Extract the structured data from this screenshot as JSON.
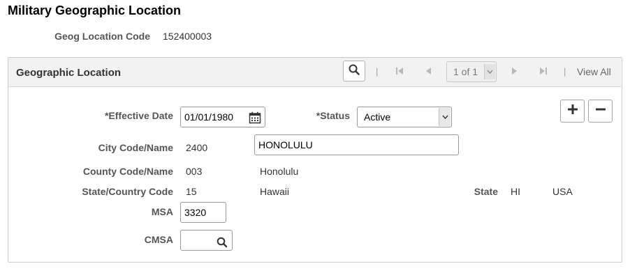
{
  "page_title": "Military Geographic Location",
  "header": {
    "geog_code_label": "Geog Location Code",
    "geog_code_value": "152400003"
  },
  "panel": {
    "title": "Geographic Location",
    "pager_text": "1 of 1",
    "view_all": "View All",
    "separators": [
      "|",
      "|",
      "|"
    ]
  },
  "form": {
    "effective_date_label": "*Effective Date",
    "effective_date_value": "01/01/1980",
    "status_label": "*Status",
    "status_value": "Active",
    "city_label": "City Code/Name",
    "city_code": "2400",
    "city_name": "HONOLULU",
    "county_label": "County Code/Name",
    "county_code": "003",
    "county_name": "Honolulu",
    "state_country_label": "State/Country Code",
    "state_country_code": "15",
    "state_country_name": "Hawaii",
    "state_label": "State",
    "state_value": "HI",
    "country_value": "USA",
    "msa_label": "MSA",
    "msa_value": "3320",
    "cmsa_label": "CMSA",
    "cmsa_value": ""
  },
  "icons": {
    "search": "search-icon",
    "first": "first-page-icon",
    "prev": "previous-icon",
    "next": "next-icon",
    "last": "last-page-icon",
    "calendar": "calendar-icon",
    "add": "plus-icon",
    "remove": "minus-icon"
  }
}
